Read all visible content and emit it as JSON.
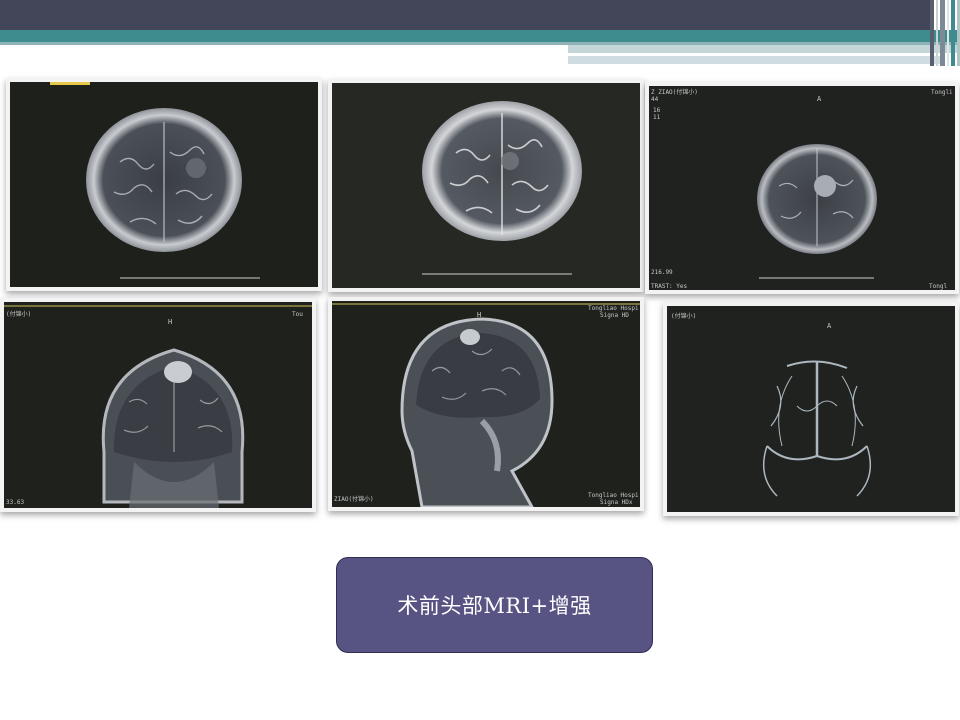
{
  "slide": {
    "caption": "术前头部MRI+增强",
    "colors": {
      "title_bar": "#434558",
      "accent_teal": "#3e8c8e",
      "caption_fill": "#575383"
    }
  },
  "images": [
    {
      "id": "axial-t1",
      "view": "axial",
      "overlay": {
        "top_left": "",
        "top_center": "",
        "top_right": "",
        "bottom_left": "",
        "bottom_right": ""
      }
    },
    {
      "id": "axial-t2",
      "view": "axial",
      "overlay": {
        "top_left": "",
        "top_center": "",
        "top_right": "",
        "bottom_left": "",
        "bottom_right": ""
      }
    },
    {
      "id": "axial-contrast",
      "view": "axial",
      "overlay": {
        "top_left": "Z ZIAO(付锦小)",
        "top_center": "A",
        "top_right": "Tongli",
        "line2": "44",
        "line3": "16",
        "line4": "11",
        "bottom_left": "216.99",
        "bottom_left2": "TRAST: Yes",
        "bottom_right": "Tongl"
      }
    },
    {
      "id": "coronal-contrast",
      "view": "coronal",
      "overlay": {
        "top_left": "(付锦小)",
        "top_center": "H",
        "top_right": "Tou",
        "bottom_left": "33.63"
      }
    },
    {
      "id": "sagittal-contrast",
      "view": "sagittal",
      "overlay": {
        "top_center": "H",
        "top_right": "Tongliao Hospi",
        "top_right2": "Signa HD",
        "bottom_left": "ZIAO(付锦小)",
        "bottom_right": "Tongliao Hospi",
        "bottom_right2": "Signa HDx"
      }
    },
    {
      "id": "mrv",
      "view": "venography",
      "overlay": {
        "top_left": "(付锦小)",
        "top_center": "A"
      }
    }
  ]
}
